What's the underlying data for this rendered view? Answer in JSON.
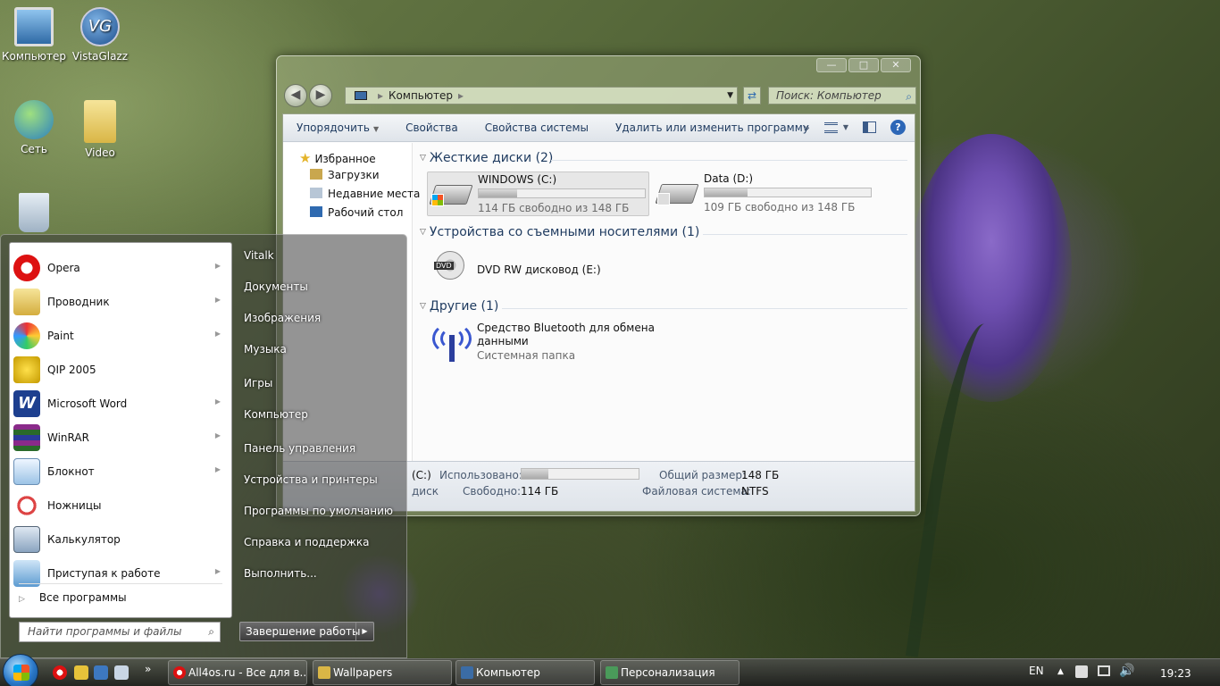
{
  "desktop": {
    "icons": [
      {
        "label": "Компьютер"
      },
      {
        "label": "VistaGlazz"
      },
      {
        "label": "Сеть"
      },
      {
        "label": "Video"
      }
    ]
  },
  "explorer": {
    "address": {
      "location": "Компьютер"
    },
    "search_placeholder": "Поиск: Компьютер",
    "toolbar": {
      "organize": "Упорядочить",
      "properties": "Свойства",
      "system_properties": "Свойства системы",
      "uninstall": "Удалить или изменить программу",
      "more": "»"
    },
    "nav": {
      "favorites": "Избранное",
      "downloads": "Загрузки",
      "recent": "Недавние места",
      "desktop": "Рабочий стол"
    },
    "groups": {
      "hard_drives": "Жесткие диски (2)",
      "removable": "Устройства со съемными носителями (1)",
      "other": "Другие (1)"
    },
    "drives": [
      {
        "name": "WINDOWS (C:)",
        "free": "114 ГБ свободно из 148 ГБ",
        "used_fraction": 0.23
      },
      {
        "name": "Data (D:)",
        "free": "109 ГБ свободно из 148 ГБ",
        "used_fraction": 0.26
      }
    ],
    "dvd": {
      "name": "DVD RW дисковод (E:)",
      "badge": "DVD"
    },
    "bluetooth": {
      "name_line1": "Средство Bluetooth для обмена",
      "name_line2": "данными",
      "type": "Системная папка"
    },
    "details": {
      "drive": "(C:)",
      "kind": "диск",
      "used_label": "Использовано:",
      "used_fraction": 0.23,
      "free_label": "Свободно:",
      "free_value": "114 ГБ",
      "total_label": "Общий размер:",
      "total_value": "148 ГБ",
      "fs_label": "Файловая система:",
      "fs_value": "NTFS"
    }
  },
  "start_menu": {
    "programs": [
      {
        "label": "Opera",
        "arrow": true
      },
      {
        "label": "Проводник",
        "arrow": true
      },
      {
        "label": "Paint",
        "arrow": true
      },
      {
        "label": "QIP 2005",
        "arrow": false
      },
      {
        "label": "Microsoft Word",
        "arrow": true
      },
      {
        "label": "WinRAR",
        "arrow": true
      },
      {
        "label": "Блокнот",
        "arrow": true
      },
      {
        "label": "Ножницы",
        "arrow": false
      },
      {
        "label": "Калькулятор",
        "arrow": false
      },
      {
        "label": "Приступая к работе",
        "arrow": true
      }
    ],
    "all_programs": "Все программы",
    "search_placeholder": "Найти программы и файлы",
    "right_items": [
      "Vitalk",
      "Документы",
      "Изображения",
      "Музыка",
      "Игры",
      "Компьютер",
      "Панель управления",
      "Устройства и принтеры",
      "Программы по умолчанию",
      "Справка и поддержка",
      "Выполнить..."
    ],
    "shutdown": "Завершение работы"
  },
  "taskbar": {
    "tasks": [
      {
        "label": "All4os.ru - Все для в..."
      },
      {
        "label": "Wallpapers"
      },
      {
        "label": "Компьютер"
      },
      {
        "label": "Персонализация"
      }
    ],
    "quicklaunch_more": "»",
    "language": "EN",
    "clock": "19:23"
  }
}
